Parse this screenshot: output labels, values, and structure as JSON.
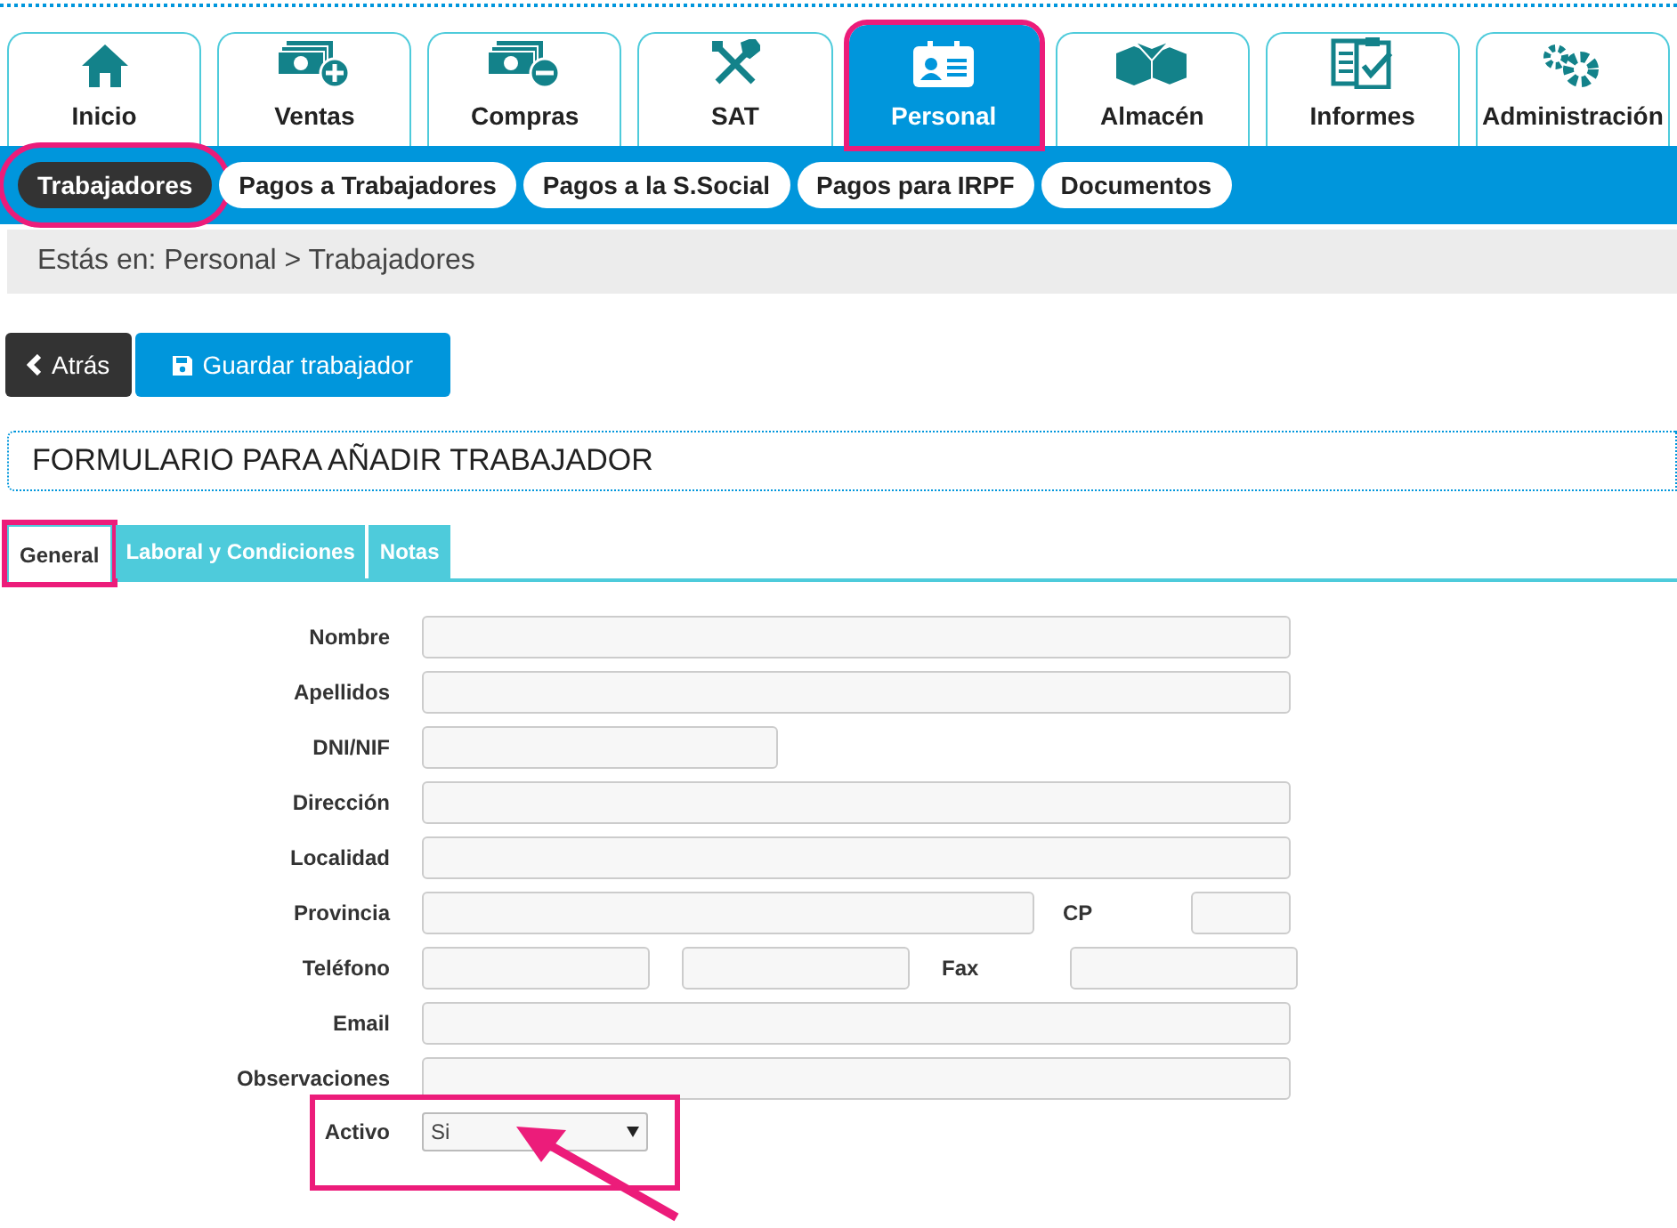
{
  "main_tabs": [
    {
      "label": "Inicio",
      "selected": false,
      "highlighted": false
    },
    {
      "label": "Ventas",
      "selected": false,
      "highlighted": false
    },
    {
      "label": "Compras",
      "selected": false,
      "highlighted": false
    },
    {
      "label": "SAT",
      "selected": false,
      "highlighted": false
    },
    {
      "label": "Personal",
      "selected": true,
      "highlighted": true
    },
    {
      "label": "Almacén",
      "selected": false,
      "highlighted": false
    },
    {
      "label": "Informes",
      "selected": false,
      "highlighted": false
    },
    {
      "label": "Administración",
      "selected": false,
      "highlighted": false
    }
  ],
  "sub_tabs": [
    {
      "label": "Trabajadores",
      "selected": true,
      "highlighted": true
    },
    {
      "label": "Pagos a Trabajadores",
      "selected": false,
      "highlighted": false
    },
    {
      "label": "Pagos a la S.Social",
      "selected": false,
      "highlighted": false
    },
    {
      "label": "Pagos para IRPF",
      "selected": false,
      "highlighted": false
    },
    {
      "label": "Documentos",
      "selected": false,
      "highlighted": false
    }
  ],
  "breadcrumb": "Estás en: Personal > Trabajadores",
  "buttons": [
    {
      "kind": "back",
      "label": "Atrás"
    },
    {
      "kind": "save",
      "label": "Guardar trabajador"
    }
  ],
  "form_title": "FORMULARIO PARA AÑADIR TRABAJADOR",
  "form_tabs": [
    {
      "label": "General",
      "selected": true,
      "highlighted": true
    },
    {
      "label": "Laboral y Condiciones",
      "selected": false,
      "highlighted": false
    },
    {
      "label": "Notas",
      "selected": false,
      "highlighted": false
    }
  ],
  "fields": [
    {
      "kind": "wide",
      "label": "Nombre"
    },
    {
      "kind": "wide",
      "label": "Apellidos"
    },
    {
      "kind": "short",
      "label": "DNI/NIF"
    },
    {
      "kind": "wide",
      "label": "Dirección"
    },
    {
      "kind": "wide",
      "label": "Localidad"
    },
    {
      "kind": "with_side_field",
      "label": "Provincia",
      "side_label": "CP"
    },
    {
      "kind": "pair_with_side_field",
      "label": "Teléfono",
      "side_label": "Fax"
    },
    {
      "kind": "wide",
      "label": "Email"
    },
    {
      "kind": "wide",
      "label": "Observaciones"
    },
    {
      "kind": "select",
      "label": "Activo",
      "value": "Si",
      "highlighted": true,
      "pointed_at": true
    }
  ]
}
